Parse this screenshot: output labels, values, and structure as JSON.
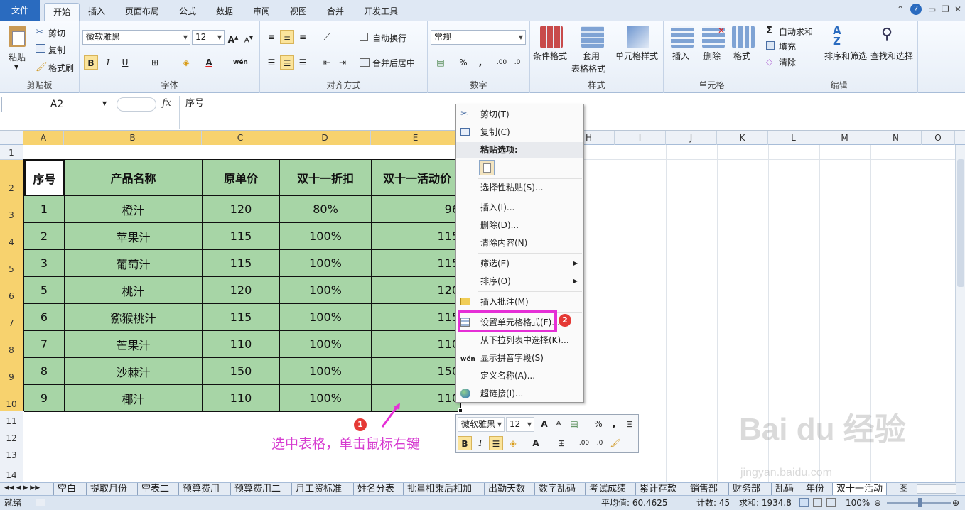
{
  "ribbon": {
    "tabs": [
      "文件",
      "开始",
      "插入",
      "页面布局",
      "公式",
      "数据",
      "审阅",
      "视图",
      "合并",
      "开发工具"
    ],
    "clipboard": {
      "paste": "粘贴",
      "cut": "剪切",
      "copy": "复制",
      "painter": "格式刷",
      "label": "剪贴板"
    },
    "font": {
      "name": "微软雅黑",
      "size": "12",
      "label": "字体"
    },
    "align": {
      "wrap": "自动换行",
      "merge": "合并后居中",
      "label": "对齐方式"
    },
    "number": {
      "format": "常规",
      "label": "数字"
    },
    "styles": {
      "cond": "条件格式",
      "table1": "套用",
      "table2": "表格格式",
      "cell": "单元格样式",
      "label": "样式"
    },
    "cells": {
      "insert": "插入",
      "delete": "删除",
      "format": "格式",
      "label": "单元格"
    },
    "edit": {
      "autosum": "自动求和",
      "fill": "填充",
      "clear": "清除",
      "sort": "排序和筛选",
      "find": "查找和选择",
      "label": "编辑"
    }
  },
  "formula": {
    "namebox": "A2",
    "fx": "fx",
    "content": "序号"
  },
  "columns": [
    "A",
    "B",
    "C",
    "D",
    "E",
    "H",
    "I",
    "J",
    "K",
    "L",
    "M",
    "N",
    "O"
  ],
  "rows": [
    "1",
    "2",
    "3",
    "4",
    "5",
    "6",
    "7",
    "8",
    "9",
    "10",
    "11",
    "12",
    "13",
    "14"
  ],
  "table": {
    "headers": [
      "序号",
      "产品名称",
      "原单价",
      "双十一折扣",
      "双十一活动价"
    ],
    "rows": [
      [
        "1",
        "橙汁",
        "120",
        "80%",
        "96"
      ],
      [
        "2",
        "苹果汁",
        "115",
        "100%",
        "115"
      ],
      [
        "3",
        "葡萄汁",
        "115",
        "100%",
        "115"
      ],
      [
        "5",
        "桃汁",
        "120",
        "100%",
        "120"
      ],
      [
        "6",
        "猕猴桃汁",
        "115",
        "100%",
        "115"
      ],
      [
        "7",
        "芒果汁",
        "110",
        "100%",
        "110"
      ],
      [
        "8",
        "沙棘汁",
        "150",
        "100%",
        "150"
      ],
      [
        "9",
        "椰汁",
        "110",
        "100%",
        "110"
      ]
    ]
  },
  "context_menu": {
    "cut": "剪切(T)",
    "copy": "复制(C)",
    "paste_options": "粘贴选项:",
    "paste_special": "选择性粘贴(S)...",
    "insert": "插入(I)...",
    "delete": "删除(D)...",
    "clear": "清除内容(N)",
    "filter": "筛选(E)",
    "sort": "排序(O)",
    "comment": "插入批注(M)",
    "format_cells": "设置单元格格式(F)...",
    "pick_list": "从下拉列表中选择(K)...",
    "phonetic": "显示拼音字段(S)",
    "define_name": "定义名称(A)...",
    "hyperlink": "超链接(I)..."
  },
  "mini_toolbar": {
    "font": "微软雅黑",
    "size": "12",
    "percent": "%",
    "comma": ","
  },
  "annotation": {
    "text": "选中表格，单击鼠标右键",
    "badge1": "1",
    "badge2": "2"
  },
  "sheets": [
    "空白",
    "提取月份",
    "空表二",
    "预算费用",
    "预算费用二",
    "月工资标准",
    "姓名分表",
    "批量相乘后相加",
    "出勤天数",
    "数字乱码",
    "考试成绩",
    "累计存款",
    "销售部",
    "财务部",
    "乱码",
    "年份",
    "双十一活动",
    "图"
  ],
  "status": {
    "ready": "就绪",
    "average": "平均值: 60.4625",
    "count": "计数: 45",
    "sum": "求和: 1934.8",
    "zoom": "100%"
  },
  "watermark": {
    "logo": "Bai du 经验",
    "url": "jingyan.baidu.com"
  },
  "colors": {
    "table_fill": "#a7d5a6",
    "highlight": "#e52fd6",
    "badge": "#e53935",
    "accent": "#2a6bbf"
  }
}
